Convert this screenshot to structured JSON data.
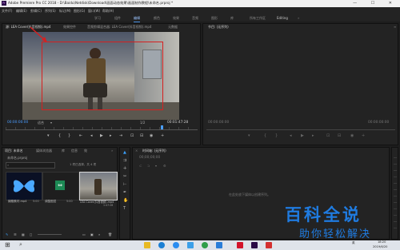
{
  "window": {
    "title": "Adobe Premiere Pro CC 2018 - D:\\Baidu\\Netdisk\\Download\\画面动态效果\\画面制作教程\\未命名.prproj *",
    "logo_text": "Pr",
    "controls": "— ☐ ✕"
  },
  "menu": [
    "文件(F)",
    "编辑(E)",
    "剪辑(C)",
    "序列(S)",
    "标记(M)",
    "图形(G)",
    "窗口(W)",
    "帮助(H)"
  ],
  "workspaces": {
    "items": [
      "学习",
      "组件",
      "编辑",
      "颜色",
      "效果",
      "音频",
      "图形",
      "库",
      "所有工作区"
    ],
    "active": "编辑",
    "editing_label": "Editing",
    "extra_icon": "double-chevron-icon"
  },
  "source_monitor": {
    "tabs": [
      "源: LEA Cover(抖音视频).mp4",
      "效果控件",
      "音频剪辑混合器: LEA Cover(抖音视频).mp4",
      "元数据"
    ],
    "timecode_in": "00:00:00:00",
    "fit_label": "适合",
    "resolution_label": "1/2",
    "timecode_out": "00:01:47:28",
    "annotation_color": "#d62020"
  },
  "program_monitor": {
    "title": "节目: (无序列)",
    "timecode_in": "00:00:00:00",
    "timecode_out": "00:00:00:00"
  },
  "project_panel": {
    "tabs": [
      "项目: 未命名",
      "媒体浏览器",
      "库",
      "信息",
      "效"
    ],
    "project_file": "未命名.prproj",
    "count_text": "1 项已选择，共 4 项",
    "items": [
      {
        "name": "蝴蝶素材.mp4",
        "duration": "5:00"
      },
      {
        "name": "调整图层",
        "duration": "5:00"
      },
      {
        "name": "LEA Cover(抖音视频).mp4",
        "duration": "1:47:28"
      }
    ]
  },
  "timeline": {
    "title": "时间轴: (无序列)",
    "timecode": "00;00;00;00",
    "empty_message": "在此处放下媒体以创建序列。"
  },
  "taskbar": {
    "time": "18:20",
    "date": "2019/6/20",
    "lang": "英"
  },
  "watermark": {
    "title": "百科全说",
    "subtitle": "助你轻松解决"
  }
}
